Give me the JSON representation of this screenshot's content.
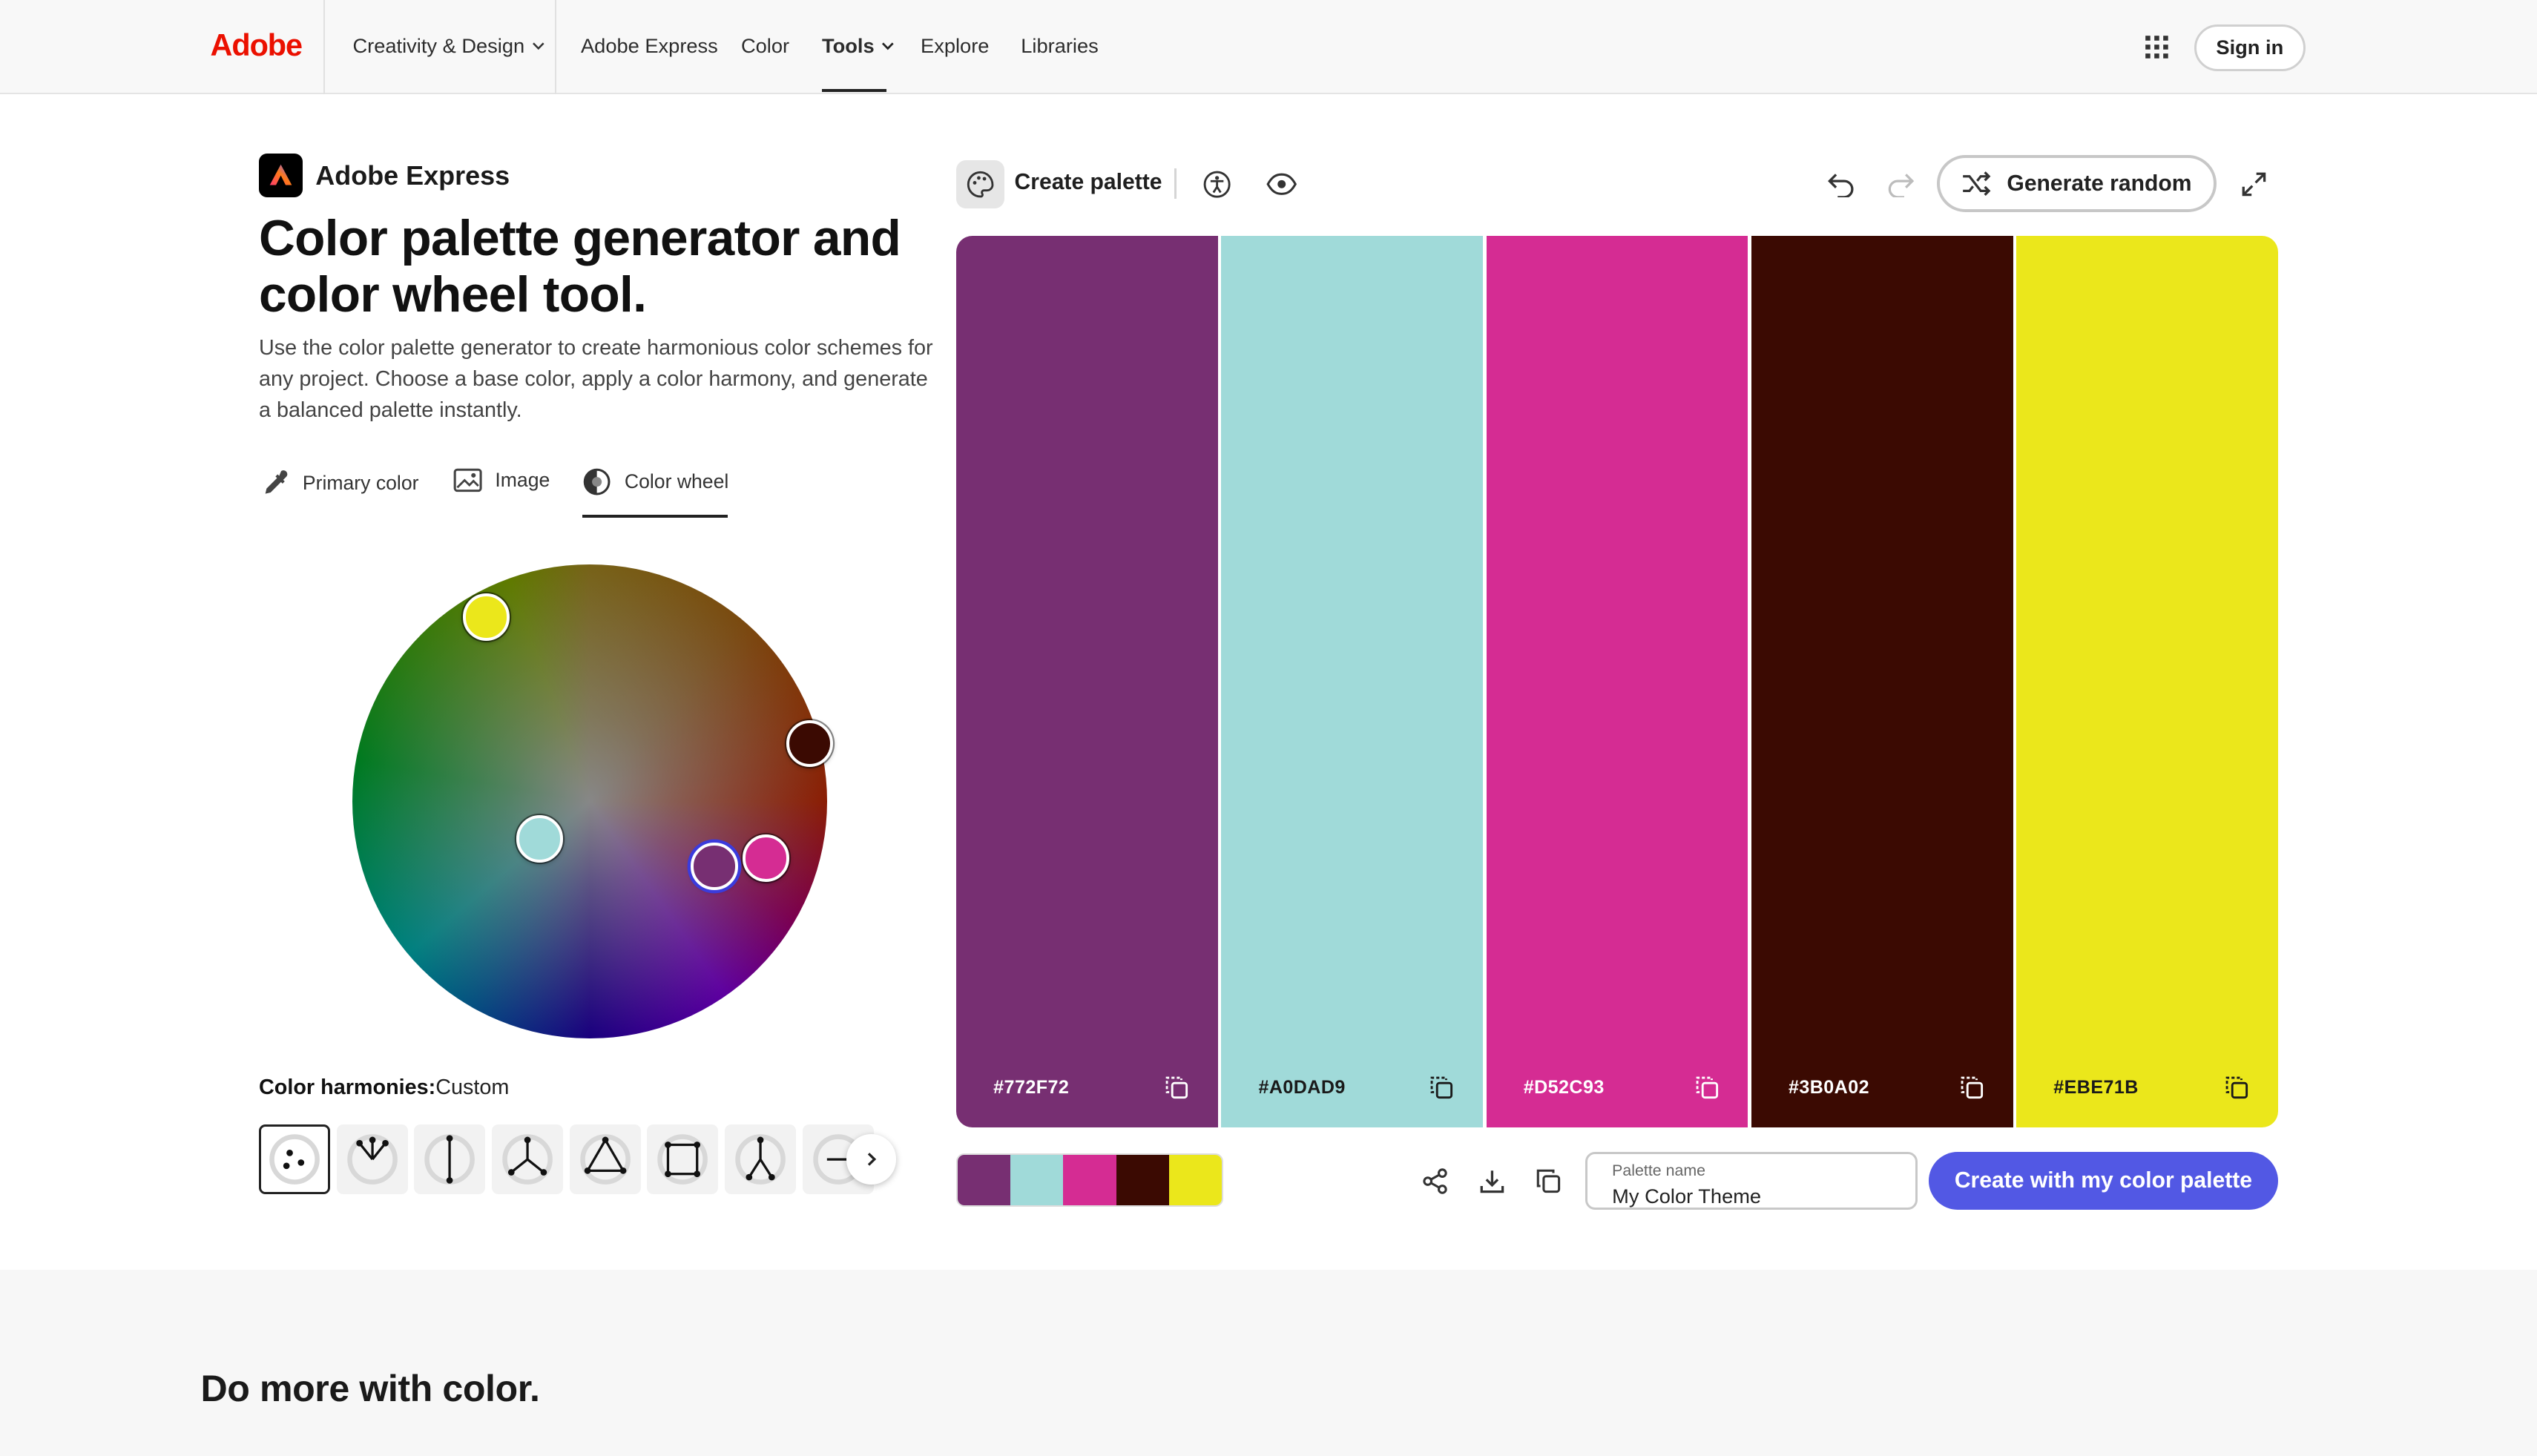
{
  "nav": {
    "logo": "Adobe",
    "items": [
      "Creativity & Design",
      "Adobe Express",
      "Color",
      "Tools",
      "Explore",
      "Libraries"
    ],
    "active": "Tools",
    "sign_in": "Sign in"
  },
  "hero": {
    "brand": "Adobe Express",
    "title": "Color palette generator and color wheel tool.",
    "description": "Use the color palette generator to create harmonious color schemes for any project. Choose a base color, apply a color harmony, and generate a balanced palette instantly."
  },
  "modes": {
    "items": [
      "Primary color",
      "Image",
      "Color wheel"
    ],
    "active": "Color wheel"
  },
  "harmonies": {
    "label": "Color harmonies:",
    "value": "Custom",
    "options": [
      "custom",
      "analogous",
      "complementary",
      "split-complementary",
      "triad",
      "square",
      "compound",
      "shades"
    ]
  },
  "toolbar": {
    "create_palette": "Create palette",
    "generate_random": "Generate random"
  },
  "palette": {
    "swatches": [
      {
        "hex": "#772F72",
        "color": "#772F72",
        "text_color": "#ffffff"
      },
      {
        "hex": "#A0DAD9",
        "color": "#A0DAD9",
        "text_color": "#1a1a1a"
      },
      {
        "hex": "#D52C93",
        "color": "#D52C93",
        "text_color": "#ffffff"
      },
      {
        "hex": "#3B0A02",
        "color": "#3B0A02",
        "text_color": "#ffffff"
      },
      {
        "hex": "#EBE71B",
        "color": "#EBE71B",
        "text_color": "#1a1a1a"
      }
    ],
    "name_label": "Palette name",
    "name_value": "My Color Theme",
    "create_button": "Create with my color palette"
  },
  "bottom": {
    "title": "Do more with color."
  },
  "colors": {
    "accent": "#5258E4",
    "brand_red": "#EB1000"
  }
}
